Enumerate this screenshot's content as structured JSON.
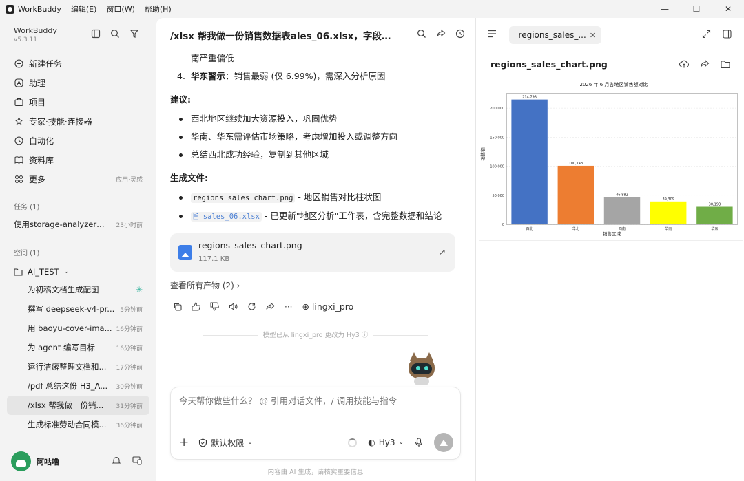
{
  "app": {
    "name": "WorkBuddy",
    "menus": [
      "编辑(E)",
      "窗口(W)",
      "帮助(H)"
    ]
  },
  "sidebar": {
    "brand": "WorkBuddy",
    "version": "v5.3.11",
    "nav": [
      {
        "label": "新建任务",
        "icon": "plus-circle-icon"
      },
      {
        "label": "助理",
        "icon": "assistant-icon"
      },
      {
        "label": "项目",
        "icon": "project-icon"
      },
      {
        "label": "专家·技能·连接器",
        "icon": "expert-icon"
      },
      {
        "label": "自动化",
        "icon": "clock-icon"
      },
      {
        "label": "资料库",
        "icon": "book-icon"
      },
      {
        "label": "更多",
        "icon": "grid-icon",
        "sub": "应用·灵感"
      }
    ],
    "tasks_header": "任务 (1)",
    "tasks": [
      {
        "title": "使用storage-analyzer分...",
        "time": "23小时前"
      }
    ],
    "space_header": "空间 (1)",
    "folder": "AI_TEST",
    "space_tasks": [
      {
        "title": "为初稿文档生成配图",
        "time": ""
      },
      {
        "title": "撰写 deepseek-v4-pr...",
        "time": "5分钟前"
      },
      {
        "title": "用 baoyu-cover-ima...",
        "time": "16分钟前"
      },
      {
        "title": "为 agent 编写目标",
        "time": "16分钟前"
      },
      {
        "title": "运行洁癖整理文档和...",
        "time": "17分钟前"
      },
      {
        "title": "/pdf 总结这份 H3_A...",
        "time": "30分钟前"
      },
      {
        "title": "/xlsx 帮我做一份销...",
        "time": "31分钟前"
      },
      {
        "title": "生成标准劳动合同模...",
        "time": "36分钟前"
      }
    ],
    "user": "阿咕噜"
  },
  "chat": {
    "title": "/xlsx 帮我做一份销售数据表ales_06.xlsx，字段你帮...",
    "top_line": "南严重偏低",
    "item4_num": "4.",
    "item4_bold": "华东警示",
    "item4_text": "：销售最弱 (仅 6.99%)，需深入分析原因",
    "suggest_heading": "建议:",
    "suggestions": [
      "西北地区继续加大资源投入，巩固优势",
      "华南、华东需评估市场策略，考虑增加投入或调整方向",
      "总结西北成功经验，复制到其他区域"
    ],
    "files_heading": "生成文件:",
    "file1_code": "regions_sales_chart.png",
    "file1_desc": " - 地区销售对比柱状图",
    "file2_code": "sales_06.xlsx",
    "file2_desc": " - 已更新\"地区分析\"工作表，含完整数据和结论",
    "card_name": "regions_sales_chart.png",
    "card_size": "117.1 KB",
    "all_products": "查看所有产物 (2)",
    "model_tag": "lingxi_pro",
    "switch_note": "模型已从 lingxi_pro 更改为 Hy3",
    "input_placeholder": "今天帮你做些什么？ @ 引用对话文件，/ 调用技能与指令",
    "permission": "默认权限",
    "model": "Hy3",
    "footer": "内容由 AI 生成，请核实重要信息"
  },
  "preview": {
    "tab": "regions_sales_...",
    "file": "regions_sales_chart.png"
  },
  "chart_data": {
    "type": "bar",
    "title": "2026 年 6 月各地区销售额对比",
    "xlabel": "销售区域",
    "ylabel": "销售额",
    "categories": [
      "西北",
      "华北",
      "西南",
      "华南",
      "华东"
    ],
    "values": [
      214793,
      100743,
      46882,
      39309,
      30193
    ],
    "value_labels": [
      "214,793",
      "100,743",
      "46,882",
      "39,309",
      "30,193"
    ],
    "colors": [
      "#4472c4",
      "#ed7d31",
      "#a5a5a5",
      "#ffff00",
      "#70ad47"
    ],
    "yticks": [
      0,
      50000,
      100000,
      150000,
      200000
    ],
    "ytick_labels": [
      "0",
      "50,000",
      "100,000",
      "150,000",
      "200,000"
    ],
    "ylim": [
      0,
      225000
    ],
    "grid": true
  }
}
